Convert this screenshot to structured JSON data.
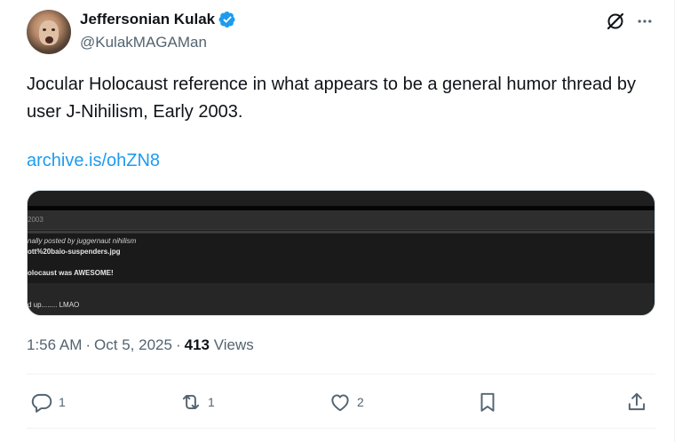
{
  "author": {
    "display_name": "Jeffersonian Kulak",
    "handle": "@KulakMAGAMan",
    "verified": true,
    "verified_color": "#1d9bf0"
  },
  "tweet": {
    "text": "Jocular Holocaust reference in what appears to be a general humor thread by user J-Nihilism,  Early 2003.",
    "link": "archive.is/ohZN8"
  },
  "media": {
    "date": "2003",
    "quote_header": "nally posted by juggernaut nihilism",
    "image_line": "ott%20baio-suspenders.jpg",
    "bold_line": "olocaust was AWESOME!",
    "reply_line": "d up........ LMAO"
  },
  "meta": {
    "time": "1:56 AM",
    "separator1": "·",
    "date": "Oct 5, 2025",
    "separator2": "·",
    "views_count": "413",
    "views_label": "Views"
  },
  "actions": {
    "reply": {
      "icon": "reply-icon",
      "count": "1"
    },
    "repost": {
      "icon": "repost-icon",
      "count": "1"
    },
    "like": {
      "icon": "heart-icon",
      "count": "2"
    },
    "bookmark": {
      "icon": "bookmark-icon"
    },
    "share": {
      "icon": "share-icon"
    }
  },
  "colors": {
    "text_primary": "#0f1419",
    "text_secondary": "#536471",
    "link": "#1d9bf0"
  }
}
